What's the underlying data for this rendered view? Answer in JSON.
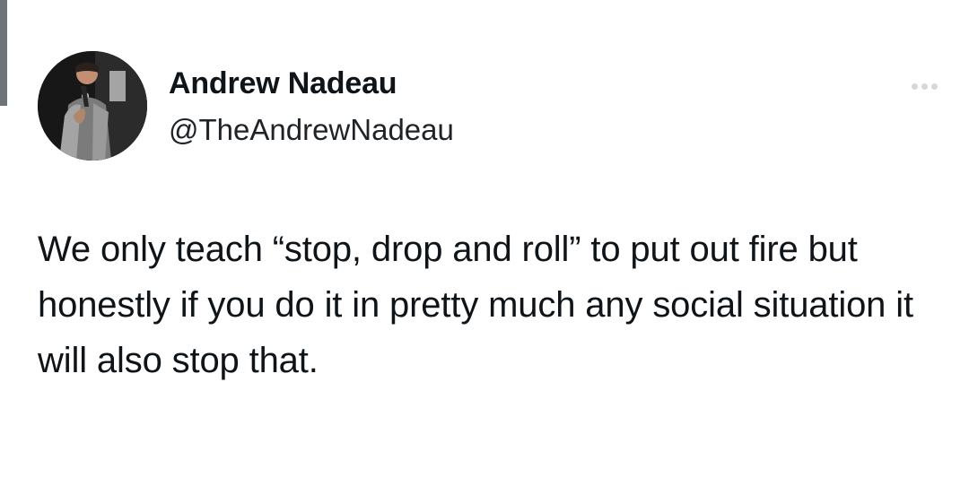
{
  "post": {
    "author": {
      "display_name": "Andrew Nadeau",
      "handle": "@TheAndrewNadeau",
      "avatar_icon": "avatar-photo-comedian-with-microphone"
    },
    "menu_icon": "more-options-icon",
    "text": "We only teach “stop, drop and roll” to put out fire but honestly if you do it in pretty much any social situation it will also stop that."
  },
  "colors": {
    "background": "#ffffff",
    "text_primary": "#0f1419",
    "text_secondary": "#1f2328",
    "more_icon": "#d4d8dc"
  }
}
